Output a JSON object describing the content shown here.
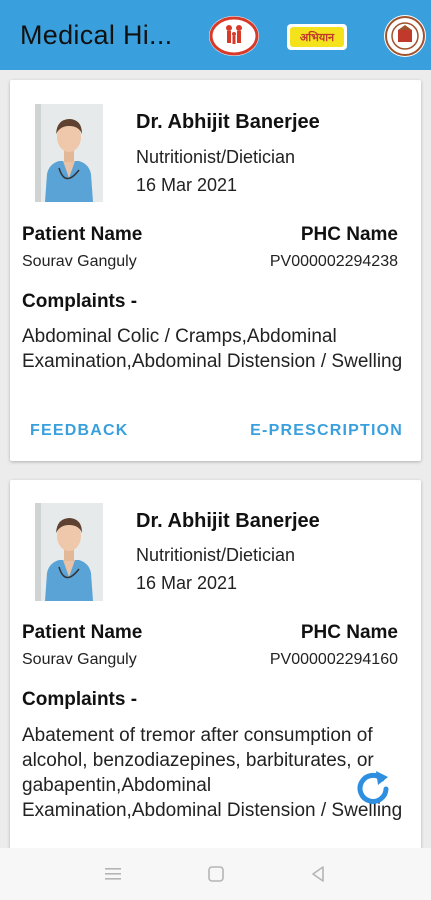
{
  "header": {
    "title": "Medical Hi..."
  },
  "logos": [
    {
      "name": "health-mission-logo"
    },
    {
      "name": "abhiyan-logo",
      "text": "अभियान"
    },
    {
      "name": "government-seal-logo"
    }
  ],
  "records": [
    {
      "doctor_name": "Dr. Abhijit  Banerjee",
      "specialty": "Nutritionist/Dietician",
      "date": "16 Mar 2021",
      "patient_label": "Patient Name",
      "patient_name": "Sourav Ganguly",
      "phc_label": "PHC Name",
      "phc_name": "PV000002294238",
      "complaints_label": "Complaints -",
      "complaints_text": "Abdominal Colic / Cramps,Abdominal Examination,Abdominal Distension / Swelling",
      "feedback_label": "FEEDBACK",
      "prescription_label": "E-PRESCRIPTION"
    },
    {
      "doctor_name": "Dr. Abhijit  Banerjee",
      "specialty": "Nutritionist/Dietician",
      "date": "16 Mar 2021",
      "patient_label": "Patient Name",
      "patient_name": "Sourav Ganguly",
      "phc_label": "PHC Name",
      "phc_name": "PV000002294160",
      "complaints_label": "Complaints -",
      "complaints_text": "Abatement of tremor after consumption of alcohol, benzodiazepines, barbiturates, or gabapentin,Abdominal Examination,Abdominal Distension / Swelling"
    }
  ],
  "colors": {
    "accent": "#3aa0dd",
    "background": "#ececec",
    "card": "#ffffff"
  },
  "navigation": [
    "menu-icon",
    "home-icon",
    "back-icon"
  ]
}
